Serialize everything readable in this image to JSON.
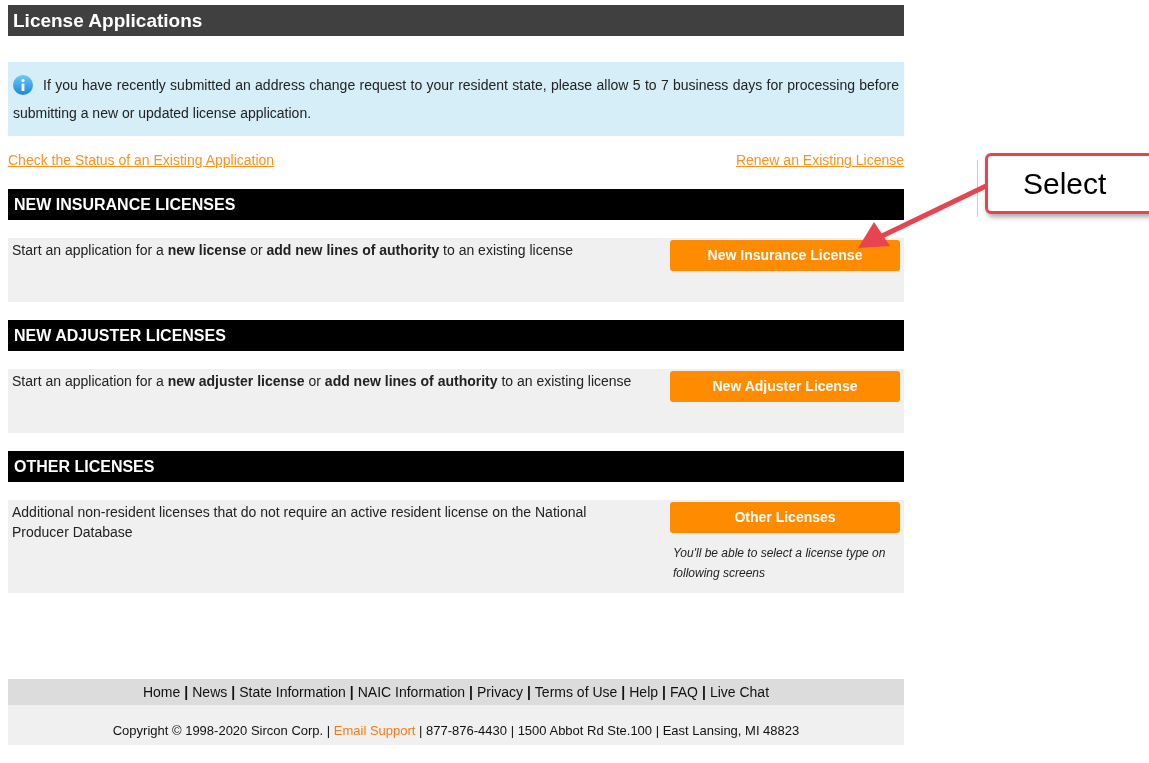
{
  "title": "License Applications",
  "notice": "If you have recently submitted an address change request to your resident state, please allow 5 to 7 business days for processing before submitting a new or updated license application.",
  "links": {
    "left": "Check the Status of an Existing Application",
    "right": "Renew an Existing License"
  },
  "sections": [
    {
      "heading": "NEW INSURANCE LICENSES",
      "description": "Start an application for a **new license** or **add new lines of authority** to an existing license",
      "button": "New Insurance License"
    },
    {
      "heading": "NEW ADJUSTER LICENSES",
      "description": "Start an application for a **new adjuster license** or **add new lines of authority** to an existing license",
      "button": "New Adjuster License"
    },
    {
      "heading": "OTHER LICENSES",
      "description": "Additional non-resident licenses that do not require an active resident license on the National Producer Database",
      "button": "Other Licenses",
      "note": "You'll be able to select a license type on following screens"
    }
  ],
  "footer": {
    "links": [
      "Home",
      "News",
      "State Information",
      "NAIC Information",
      "Privacy",
      "Terms of Use",
      "Help",
      "FAQ",
      "Live Chat"
    ],
    "separator": "|",
    "copyright_before": "Copyright © 1998-2020 Sircon Corp. |",
    "email_link": "Email Support",
    "copyright_after": "| 877-876-4430 | 1500 Abbot Rd Ste.100 | East Lansing, MI 48823"
  },
  "callout": {
    "label": "Select"
  }
}
